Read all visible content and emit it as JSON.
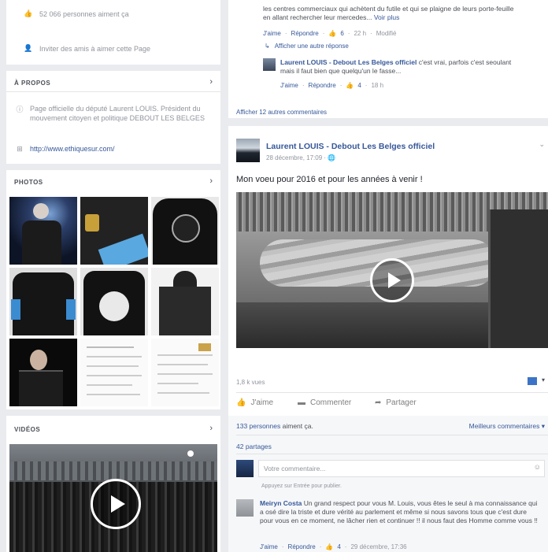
{
  "left": {
    "likes_text": "52 066 personnes aiment ça",
    "invite_text": "Inviter des amis à aimer cette Page",
    "about": {
      "title": "À PROPOS",
      "description": "Page officielle du député Laurent LOUIS. Président du mouvement citoyen et politique DEBOUT LES BELGES",
      "website": "http://www.ethiquesur.com/"
    },
    "photos_title": "PHOTOS",
    "videos_title": "VIDÉOS"
  },
  "top_thread": {
    "snippet": "les centres commerciaux qui achètent du futile et qui se plaigne de leurs porte-feuille en allant rechercher leur mercedes...",
    "see_more": "Voir plus",
    "actions": {
      "like": "J'aime",
      "reply": "Répondre",
      "count": "6",
      "time": "22 h",
      "edited": "Modifié"
    },
    "show_reply": "Afficher une autre réponse",
    "reply": {
      "author": "Laurent LOUIS - Debout Les Belges officiel",
      "text": "c'est vrai, parfois c'est seoulant mais il faut bien que quelqu'un le fasse...",
      "like": "J'aime",
      "reply_label": "Répondre",
      "count": "4",
      "time": "18 h"
    },
    "more_comments": "Afficher 12 autres commentaires"
  },
  "post": {
    "author": "Laurent LOUIS - Debout Les Belges officiel",
    "date": "28 décembre, 17:09",
    "text": "Mon voeu pour 2016 et pour les années à venir !",
    "views": "1,8 k vues",
    "actions": {
      "like": "J'aime",
      "comment": "Commenter",
      "share": "Partager"
    },
    "likes_count": "133 personnes",
    "likes_suffix": "aiment ça.",
    "sort": "Meilleurs commentaires ▾",
    "shares": "42 partages",
    "comment_placeholder": "Votre commentaire...",
    "posting_as": "Appuyez sur Entrée pour publier.",
    "comment": {
      "author": "Meiryn Costa",
      "text": "Un grand respect pour vous M. Louis, vous êtes le seul à ma connaissance qui a osé dire la triste et dure vérité au parlement et même si nous savons tous que c'est dure pour vous en ce moment, ne lâcher rien et continuer !! il nous faut des Homme comme vous !!",
      "like": "J'aime",
      "reply_label": "Répondre",
      "count": "4",
      "time": "29 décembre, 17:36"
    }
  },
  "colors": {
    "link": "#365899",
    "bg": "#e9ebee",
    "muted": "#90949c"
  }
}
